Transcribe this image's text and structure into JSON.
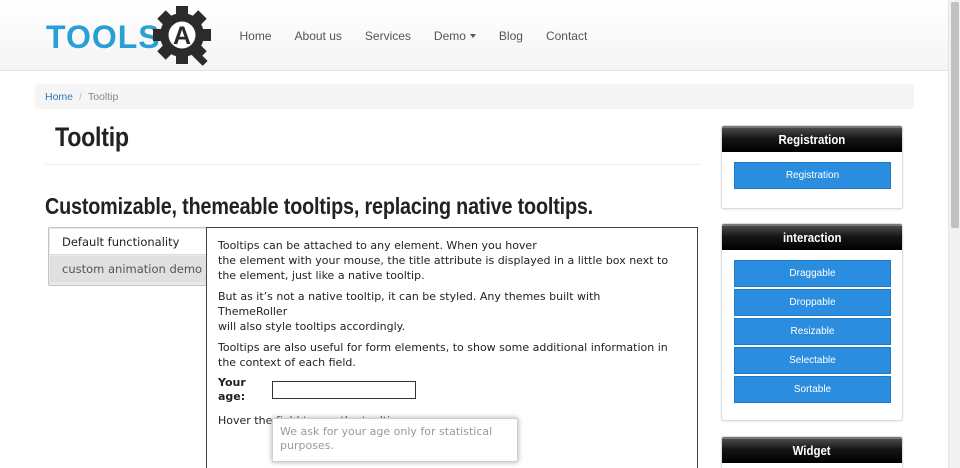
{
  "brand": {
    "logo_text": "TOOLS",
    "logo_letter": "A",
    "accent": "#2a9fd6"
  },
  "nav": {
    "items": [
      {
        "label": "Home"
      },
      {
        "label": "About us"
      },
      {
        "label": "Services"
      },
      {
        "label": "Demo"
      },
      {
        "label": "Blog"
      },
      {
        "label": "Contact"
      }
    ]
  },
  "breadcrumb": {
    "home": "Home",
    "separator": "/",
    "current": "Tooltip"
  },
  "page": {
    "title": "Tooltip",
    "subtitle": "Customizable, themeable tooltips, replacing native tooltips."
  },
  "demo": {
    "tabs": [
      {
        "label": "Default functionality"
      },
      {
        "label": "custom animation demo"
      }
    ],
    "paragraphs": [
      "Tooltips can be attached to any element. When you hover",
      "the element with your mouse, the title attribute is displayed in a little box next to the element, just like a native tooltip.",
      "But as it’s not a native tooltip, it can be styled. Any themes built with",
      "ThemeRoller",
      "will also style tooltips accordingly.",
      "Tooltips are also useful for form elements, to show some additional information in the context of each field."
    ],
    "age_label": "Your age:",
    "age_value": "",
    "hover_text": "Hover the field to see the tooltip.",
    "tooltip_text": "We ask for your age only for statistical purposes."
  },
  "sidebar": {
    "registration": {
      "title": "Registration",
      "button": "Registration"
    },
    "interaction": {
      "title": "interaction",
      "buttons": [
        "Draggable",
        "Droppable",
        "Resizable",
        "Selectable",
        "Sortable"
      ]
    },
    "widget": {
      "title": "Widget"
    },
    "button_color": "#2a8de0"
  }
}
